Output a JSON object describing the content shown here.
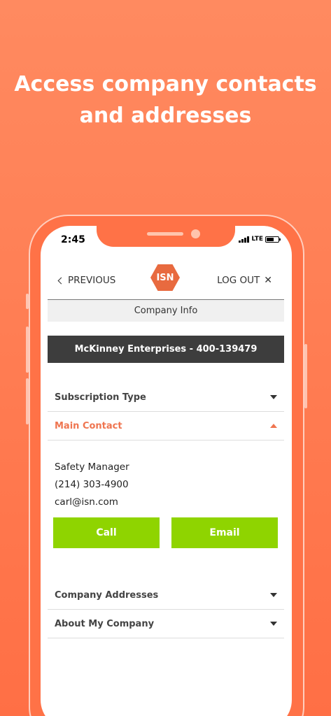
{
  "headline": {
    "line1": "Access company contacts",
    "line2": "and addresses"
  },
  "status_bar": {
    "time": "2:45",
    "network": "LTE"
  },
  "nav": {
    "previous_label": "PREVIOUS",
    "logo_text": "ISN",
    "logout_label": "LOG OUT",
    "logout_icon": "close-icon"
  },
  "page": {
    "section_title": "Company Info",
    "company_name": "McKinney Enterprises - 400-139479"
  },
  "accordion": {
    "subscription_type": "Subscription Type",
    "main_contact": "Main Contact",
    "company_addresses": "Company Addresses",
    "about_my_company": "About My Company"
  },
  "contact": {
    "title": "Safety Manager",
    "phone": "(214) 303-4900",
    "email": "carl@isn.com"
  },
  "actions": {
    "call_label": "Call",
    "email_label": "Email"
  },
  "colors": {
    "background": "#ff7247",
    "accent": "#ef7550",
    "button": "#8fd400",
    "company_bar": "#3d3d3d"
  }
}
